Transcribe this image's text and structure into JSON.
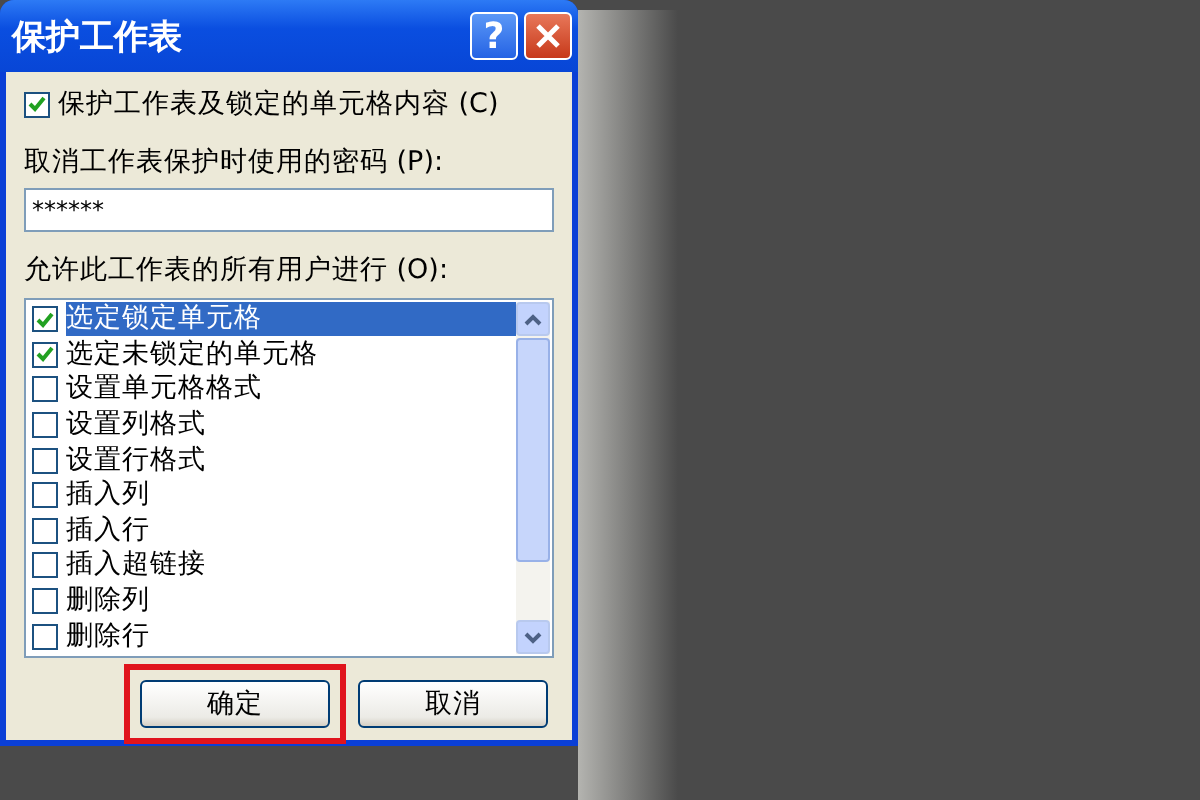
{
  "window": {
    "title": "保护工作表",
    "help_button": "?"
  },
  "protect_checkbox": {
    "label": "保护工作表及锁定的单元格内容 (C)",
    "checked": true
  },
  "password": {
    "label": "取消工作表保护时使用的密码 (P):",
    "value": "******"
  },
  "permissions": {
    "label": "允许此工作表的所有用户进行 (O):",
    "items": [
      {
        "label": "选定锁定单元格",
        "checked": true,
        "selected": true
      },
      {
        "label": "选定未锁定的单元格",
        "checked": true,
        "selected": false
      },
      {
        "label": "设置单元格格式",
        "checked": false,
        "selected": false
      },
      {
        "label": "设置列格式",
        "checked": false,
        "selected": false
      },
      {
        "label": "设置行格式",
        "checked": false,
        "selected": false
      },
      {
        "label": "插入列",
        "checked": false,
        "selected": false
      },
      {
        "label": "插入行",
        "checked": false,
        "selected": false
      },
      {
        "label": "插入超链接",
        "checked": false,
        "selected": false
      },
      {
        "label": "删除列",
        "checked": false,
        "selected": false
      },
      {
        "label": "删除行",
        "checked": false,
        "selected": false
      }
    ]
  },
  "buttons": [
    {
      "label": "确定",
      "highlighted": true
    },
    {
      "label": "取消",
      "highlighted": false
    }
  ]
}
